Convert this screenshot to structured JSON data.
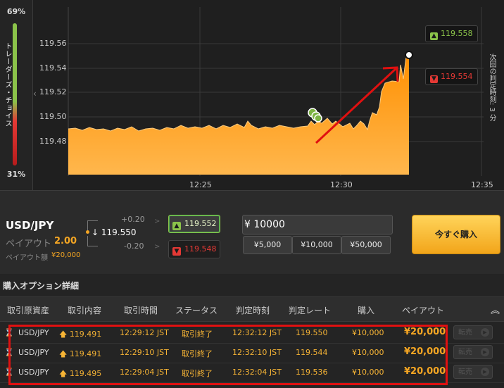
{
  "sentiment": {
    "up_percent": "69%",
    "down_percent": "31%",
    "label": "トレーダーズ・チョイス",
    "up_ratio": 0.69
  },
  "chart": {
    "y_ticks": [
      "119.56",
      "119.54",
      "119.52",
      "119.50",
      "119.48"
    ],
    "x_ticks": [
      "12:25",
      "12:30",
      "12:35"
    ],
    "high_price": "119.558",
    "low_price": "119.554",
    "next_judgement": "次回の判定時刻: 3 分",
    "back_glyph": "‹",
    "colors": {
      "area_top": "#ff9800",
      "area_bottom": "#ffb74d",
      "up": "#8bc34a",
      "down": "#e53935",
      "annotation": "#e01010"
    }
  },
  "trade": {
    "pair": "USD/JPY",
    "payout_label": "ペイアウト",
    "payout_value": "2.00",
    "payout_amount_label": "ペイアウト額",
    "payout_amount": "¥20,000",
    "current_price": "119.550",
    "offset_up": "+0.20",
    "offset_down": "-0.20",
    "high_button": "119.552",
    "low_button": "119.548",
    "amount_value": "¥ 10000",
    "presets": [
      "¥5,000",
      "¥10,000",
      "¥50,000"
    ],
    "buy_now": "今すぐ購入"
  },
  "details": {
    "title": "購入オプション詳細",
    "headers": [
      "取引原資産",
      "取引内容",
      "取引時間",
      "ステータス",
      "判定時刻",
      "判定レート",
      "購入",
      "ペイアウト"
    ],
    "rows": [
      [
        "USD/JPY",
        "119.491",
        "12:29:12 JST",
        "取引終了",
        "12:32:12 JST",
        "119.550",
        "¥10,000",
        "¥20,000"
      ],
      [
        "USD/JPY",
        "119.491",
        "12:29:10 JST",
        "取引終了",
        "12:32:10 JST",
        "119.544",
        "¥10,000",
        "¥20,000"
      ],
      [
        "USD/JPY",
        "119.495",
        "12:29:04 JST",
        "取引終了",
        "12:32:04 JST",
        "119.536",
        "¥10,000",
        "¥20,000"
      ]
    ],
    "sell_label": "転売"
  }
}
